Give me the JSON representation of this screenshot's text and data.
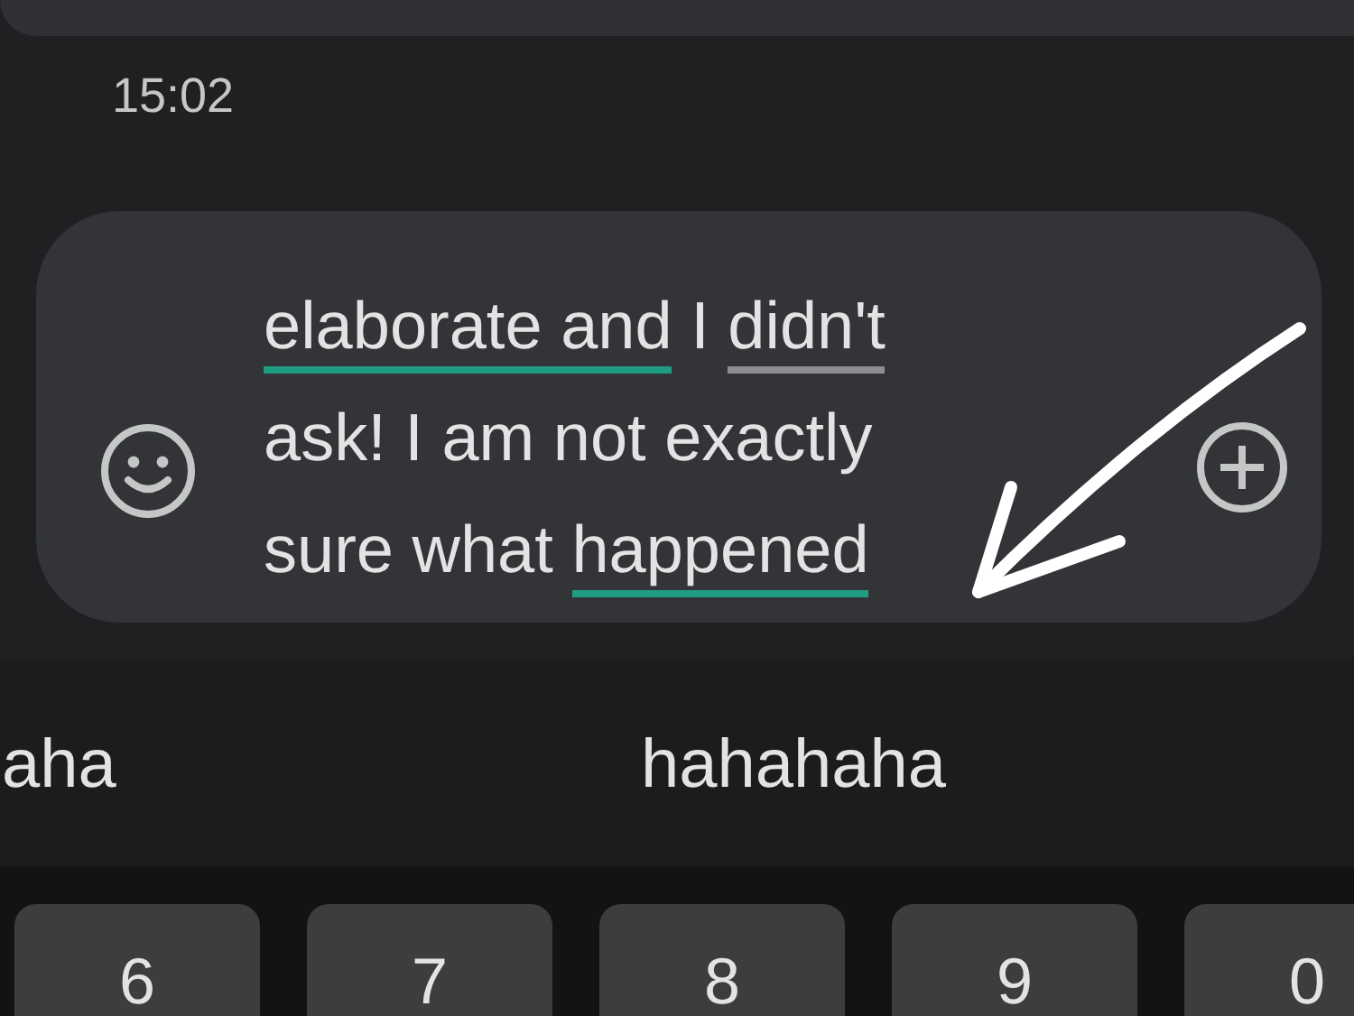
{
  "timestamp": "15:02",
  "compose": {
    "lines": [
      [
        {
          "text": "elaborate and",
          "color": "#1f9d83"
        },
        {
          "text": " I "
        },
        {
          "text": "didn't",
          "color": "#8d8e90"
        }
      ],
      [
        {
          "text": "ask! I am not exactly"
        }
      ],
      [
        {
          "text": "sure what "
        },
        {
          "text": "happened",
          "color": "#1f9d83"
        }
      ]
    ]
  },
  "suggestions": [
    "aha",
    "hahahaha"
  ],
  "keys": [
    "6",
    "7",
    "8",
    "9",
    "0"
  ]
}
